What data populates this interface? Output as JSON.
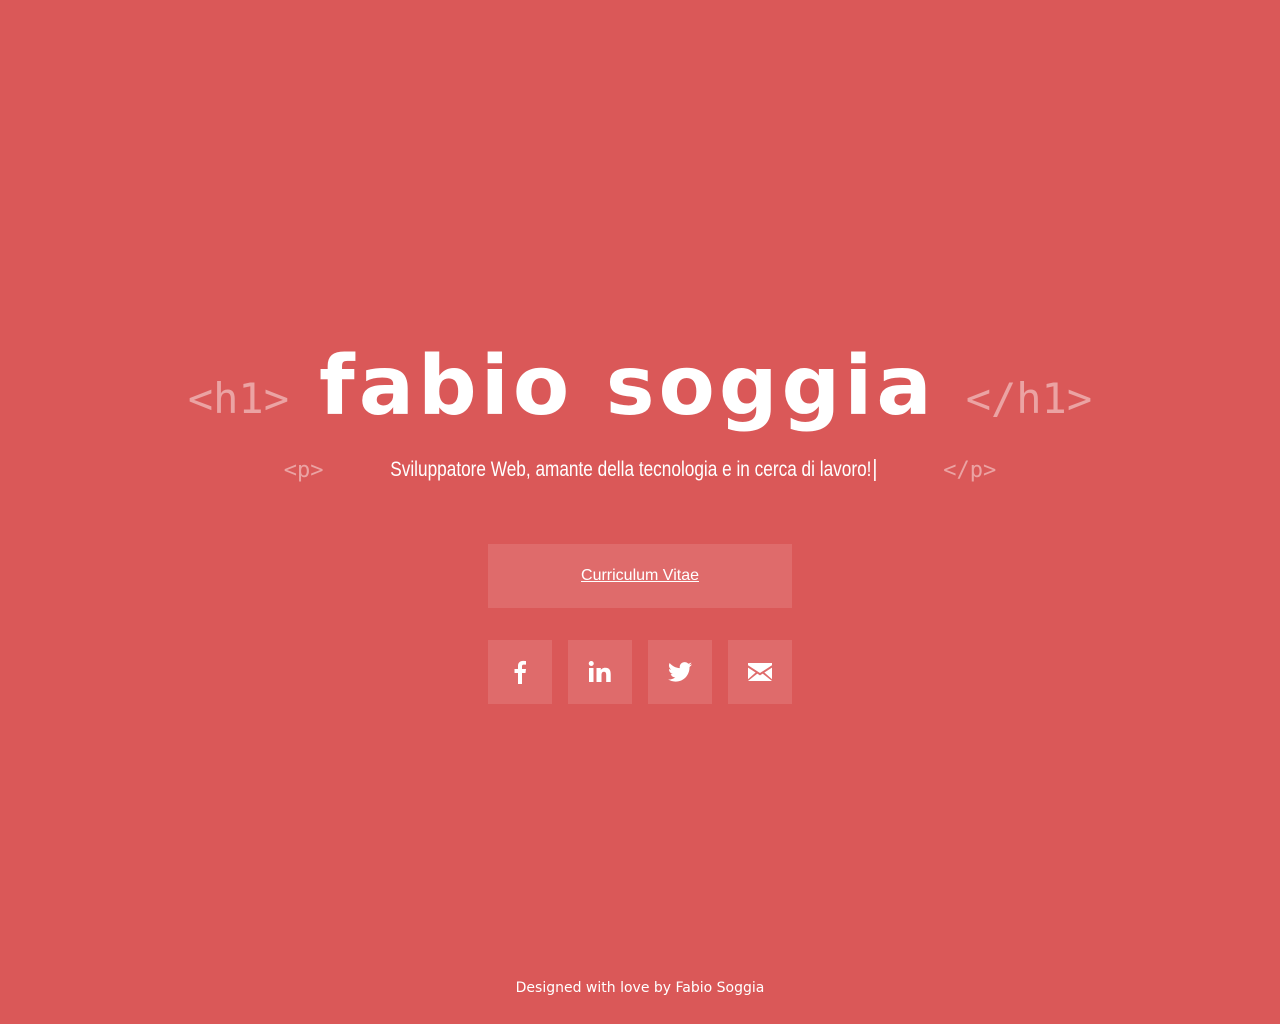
{
  "colors": {
    "background": "#da5858",
    "button": "#df6b6b",
    "text": "#ffffff",
    "code_tag": "rgba(255,255,255,0.45)"
  },
  "header": {
    "open_tag": "<h1>",
    "name": "fabio soggia",
    "close_tag": "</h1>"
  },
  "tagline": {
    "open_tag": "<p>",
    "text": "Sviluppatore Web, amante della tecnologia e in cerca di lavoro!",
    "close_tag": "</p>"
  },
  "cv_button": {
    "label": "Curriculum Vitae"
  },
  "social": [
    {
      "icon": "facebook-icon"
    },
    {
      "icon": "linkedin-icon"
    },
    {
      "icon": "twitter-icon"
    },
    {
      "icon": "mail-icon"
    }
  ],
  "footer": {
    "text": "Designed with love by Fabio Soggia"
  }
}
